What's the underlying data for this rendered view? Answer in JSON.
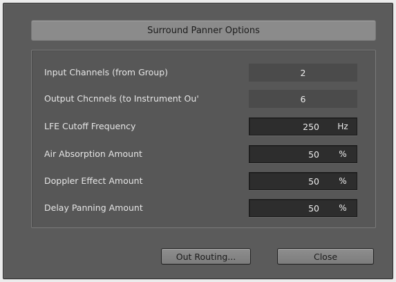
{
  "dialog": {
    "title": "Surround Panner Options"
  },
  "rows": [
    {
      "label": "Input Channels (from Group)",
      "value": "2",
      "unit": ""
    },
    {
      "label": "Output Chcnnels (to Instrument Ou'",
      "value": "6",
      "unit": ""
    },
    {
      "label": "LFE Cutoff Frequency",
      "value": "250",
      "unit": "Hz"
    },
    {
      "label": "Air Absorption Amount",
      "value": "50",
      "unit": "%"
    },
    {
      "label": "Doppler Effect Amount",
      "value": "50",
      "unit": "%"
    },
    {
      "label": "Delay Panning Amount",
      "value": "50",
      "unit": "%"
    }
  ],
  "buttons": {
    "out_routing": "Out Routing...",
    "close": "Close"
  }
}
